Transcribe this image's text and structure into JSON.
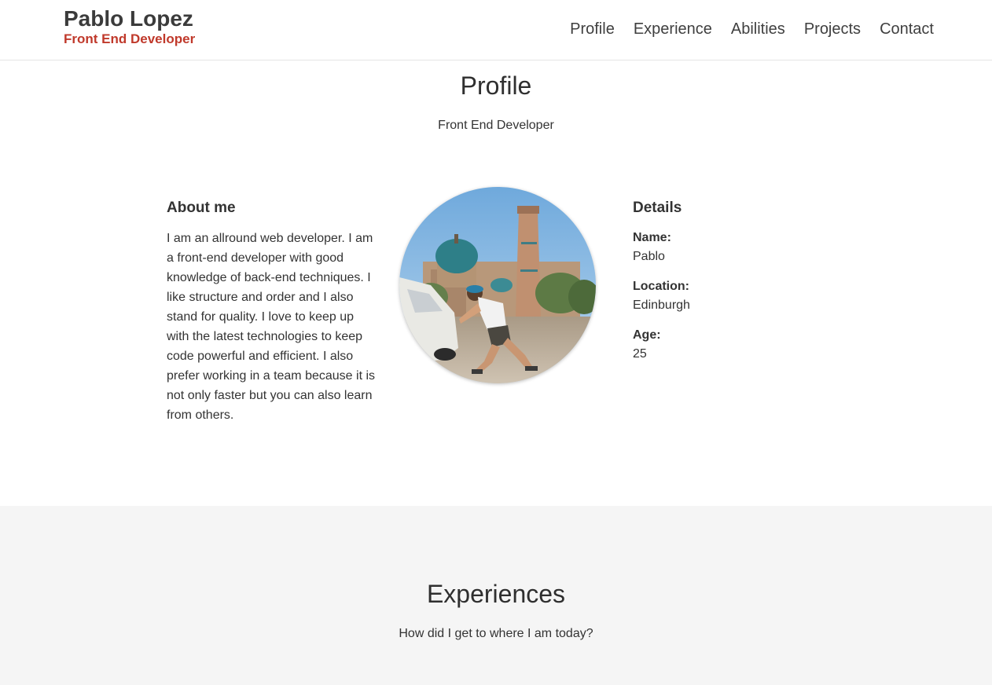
{
  "brand": {
    "name": "Pablo Lopez",
    "role": "Front End Developer"
  },
  "nav": {
    "items": [
      {
        "label": "Profile"
      },
      {
        "label": "Experience"
      },
      {
        "label": "Abilities"
      },
      {
        "label": "Projects"
      },
      {
        "label": "Contact"
      }
    ]
  },
  "profile": {
    "title": "Profile",
    "subtitle": "Front End Developer",
    "about": {
      "heading": "About me",
      "text": "I am an allround web developer. I am a front-end developer with good knowledge of back-end techniques. I like structure and order and I also stand for quality. I love to keep up with the latest technologies to keep code powerful and efficient. I also prefer working in a team because it is not only faster but you can also learn from others."
    },
    "details": {
      "heading": "Details",
      "items": [
        {
          "label": "Name:",
          "value": "Pablo"
        },
        {
          "label": "Location:",
          "value": "Edinburgh"
        },
        {
          "label": "Age:",
          "value": "25"
        }
      ]
    }
  },
  "experience": {
    "title": "Experiences",
    "subtitle": "How did I get to where I am today?"
  },
  "colors": {
    "accent": "#c0392b",
    "text": "#333333",
    "section_alt_bg": "#f5f5f5"
  }
}
